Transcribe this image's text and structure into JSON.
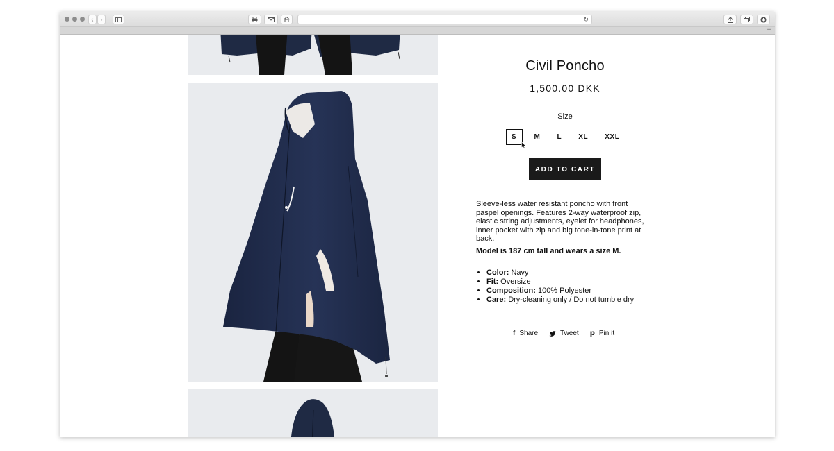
{
  "product": {
    "title": "Civil Poncho",
    "price": "1,500.00 DKK",
    "size_label": "Size",
    "sizes": [
      "S",
      "M",
      "L",
      "XL",
      "XXL"
    ],
    "selected_size": "S",
    "add_to_cart": "ADD TO CART",
    "description": "Sleeve-less water resistant poncho with front paspel openings. Features 2-way waterproof zip, elastic string adjustments, eyelet for headphones, inner pocket with zip and big tone-in-tone print at back.",
    "model_note": "Model is 187 cm tall and wears a size M.",
    "specs": [
      {
        "key": "Color:",
        "value": "Navy"
      },
      {
        "key": "Fit:",
        "value": "Oversize"
      },
      {
        "key": "Composition:",
        "value": "100% Polyester"
      },
      {
        "key": "Care:",
        "value": "Dry-cleaning only / Do not tumble dry"
      }
    ]
  },
  "social": {
    "share": "Share",
    "tweet": "Tweet",
    "pin": "Pin it"
  },
  "icons": {
    "share": "facebook-icon",
    "tweet": "twitter-icon",
    "pin": "pinterest-icon"
  },
  "colors": {
    "poncho": "#1f2a44",
    "pants": "#1a1a1a",
    "photo_bg": "#e9ebee",
    "button_bg": "#1a1a1a"
  }
}
